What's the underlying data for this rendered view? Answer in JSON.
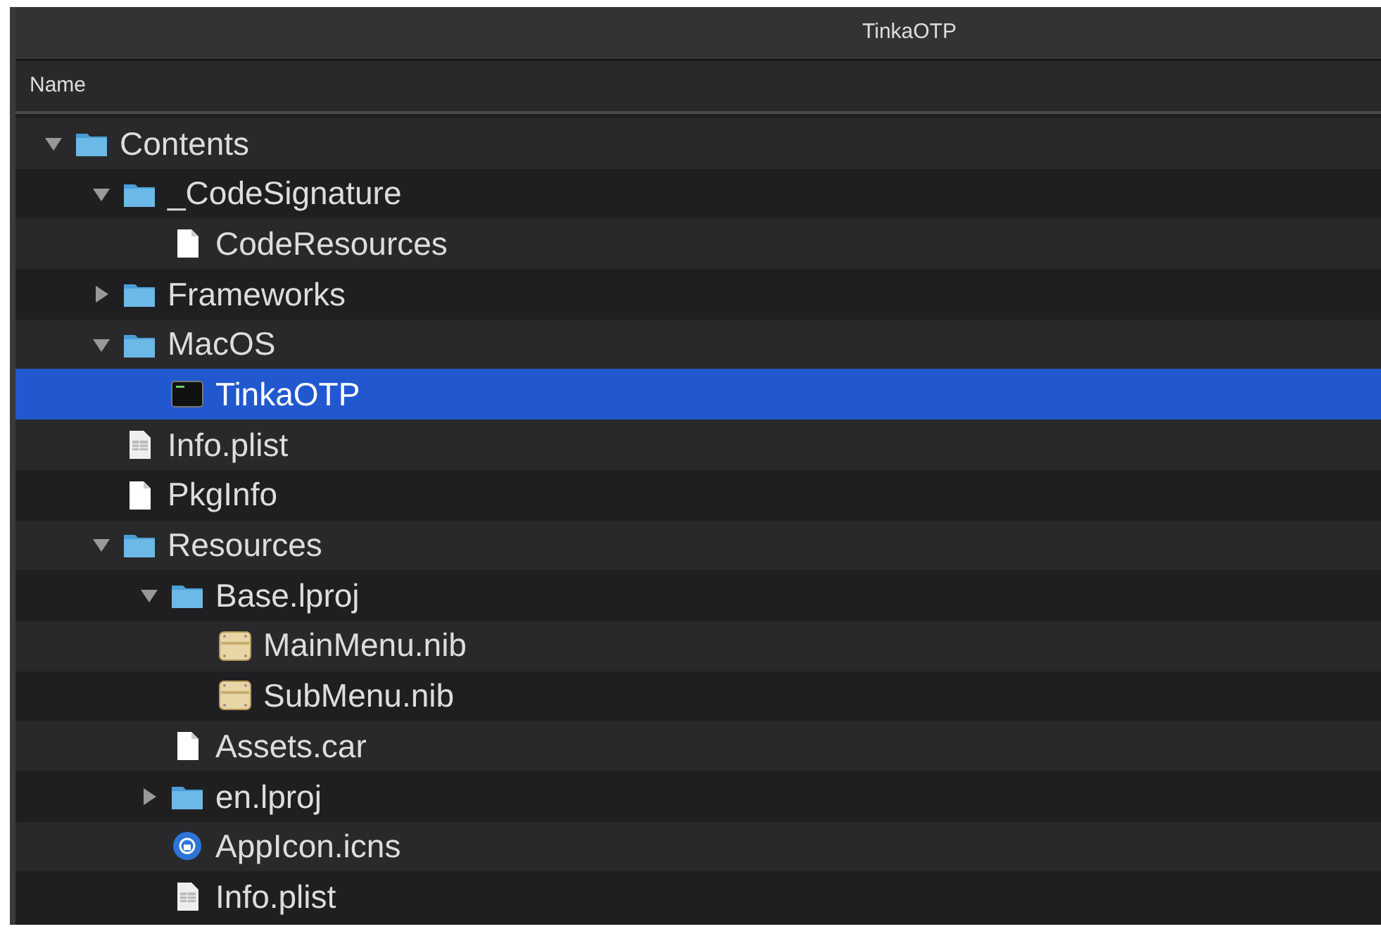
{
  "window": {
    "title": "TinkaOTP"
  },
  "columns": [
    "Name"
  ],
  "tree": [
    {
      "name": "Contents",
      "kind": "folder",
      "expanded": true,
      "selected": false,
      "children": [
        {
          "name": "_CodeSignature",
          "kind": "folder",
          "expanded": true,
          "selected": false,
          "children": [
            {
              "name": "CodeResources",
              "kind": "document",
              "selected": false
            }
          ]
        },
        {
          "name": "Frameworks",
          "kind": "folder",
          "expanded": false,
          "selected": false
        },
        {
          "name": "MacOS",
          "kind": "folder",
          "expanded": true,
          "selected": false,
          "children": [
            {
              "name": "TinkaOTP",
              "kind": "executable",
              "selected": true
            }
          ]
        },
        {
          "name": "Info.plist",
          "kind": "plist",
          "selected": false
        },
        {
          "name": "PkgInfo",
          "kind": "document",
          "selected": false
        },
        {
          "name": "Resources",
          "kind": "folder",
          "expanded": true,
          "selected": false,
          "children": [
            {
              "name": "Base.lproj",
              "kind": "folder",
              "expanded": true,
              "selected": false,
              "children": [
                {
                  "name": "MainMenu.nib",
                  "kind": "nib",
                  "selected": false
                },
                {
                  "name": "SubMenu.nib",
                  "kind": "nib",
                  "selected": false
                }
              ]
            },
            {
              "name": "Assets.car",
              "kind": "document",
              "selected": false
            },
            {
              "name": "en.lproj",
              "kind": "folder",
              "expanded": false,
              "selected": false
            },
            {
              "name": "AppIcon.icns",
              "kind": "icns",
              "selected": false
            },
            {
              "name": "Info.plist",
              "kind": "plist",
              "selected": false
            }
          ]
        }
      ]
    }
  ]
}
